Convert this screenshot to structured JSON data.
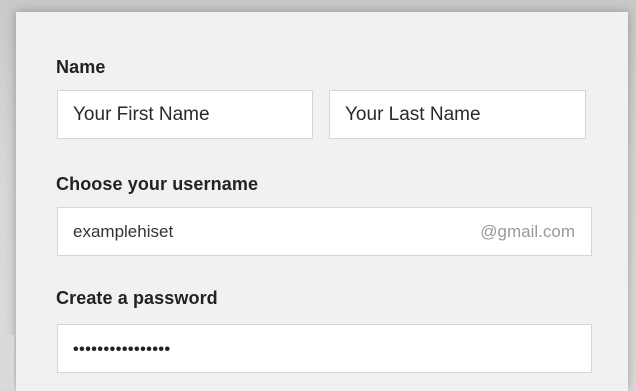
{
  "form": {
    "name_label": "Name",
    "first_name_value": "Your First Name",
    "last_name_value": "Your Last Name",
    "username_label": "Choose your username",
    "username_value": "examplehiset",
    "username_suffix": "@gmail.com",
    "password_label": "Create a password",
    "password_value": "••••••••••••••••"
  }
}
